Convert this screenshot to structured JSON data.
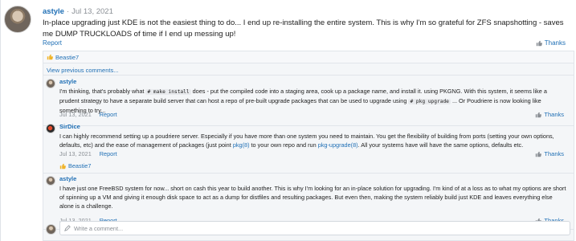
{
  "post": {
    "author": "astyle",
    "separator": "·",
    "date": "Jul 13, 2021",
    "text": "In-place upgrading just KDE is not the easiest thing to do... I end up re-installing the entire system. This is why I'm so grateful for ZFS snapshotting - saves me DUMP TRUCKLOADS of time if I end up messing up!",
    "report_label": "Report",
    "thanks_label": "Thanks"
  },
  "reactions": {
    "user": "Beastie7"
  },
  "view_previous_label": "View previous comments...",
  "comments": [
    {
      "author": "astyle",
      "text_1": "I'm thinking, that's probably what",
      "code_1": "# make install",
      "text_2": "does - put the compiled code into a staging area, cook up a package name, and install it. using PKGNG. With this system, it seems like a prudent strategy to have a separate build server that can host a repo of pre-built upgrade packages that can be used to upgrade using",
      "code_2": "# pkg upgrade",
      "text_3": "... Or Poudriere is now looking like something to try...",
      "date": "Jul 13, 2021",
      "report_label": "Report",
      "thanks_label": "Thanks"
    },
    {
      "author": "SirDice",
      "text_1": "I can highly recommend setting up a poudriere server. Especially if you have more than one system you need to maintain. You get the flexibility of building from ports (setting your own options, defaults, etc) and the ease of management of packages (just point",
      "link_1": "pkg(8)",
      "text_2": "to your own repo and run",
      "link_2": "pkg-upgrade(8)",
      "text_3": ". All your systems have will have the same options, defaults etc.",
      "date": "Jul 13, 2021",
      "report_label": "Report",
      "thanks_label": "Thanks",
      "reaction_user": "Beastie7"
    },
    {
      "author": "astyle",
      "text": "I have just one FreeBSD system for now... short on cash this year to build another. This is why I'm looking for an in-place solution for upgrading. I'm kind of at a loss as to what my options are short of spinning up a VM and giving it enough disk space to act as a dump for distfiles and resulting packages. But even then, making the system reliably build just KDE and leaves everything else alone is a challenge.",
      "date": "Jul 13, 2021",
      "report_label": "Report",
      "thanks_label": "Thanks"
    }
  ],
  "write_comment": {
    "placeholder": "Write a comment..."
  },
  "colors": {
    "link": "#1f6fb5",
    "muted": "#8a8f95",
    "thumb": "#f0b429"
  },
  "icons": {
    "thanks": "thumbs-up-icon",
    "reaction": "reaction-emoji-icon",
    "pencil": "pencil-icon"
  }
}
